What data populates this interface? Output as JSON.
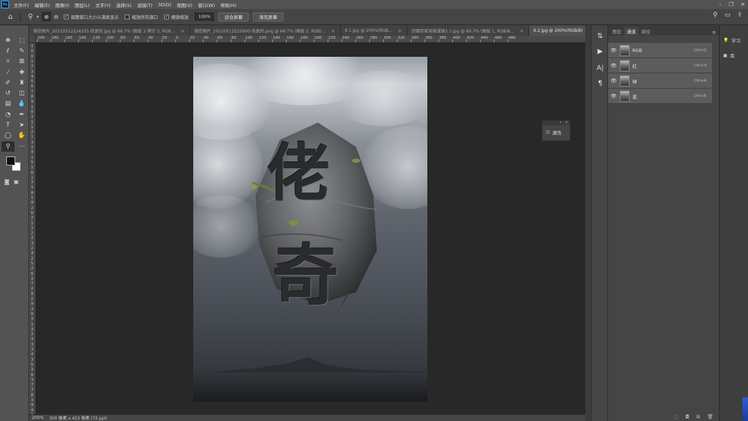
{
  "menubar": {
    "items": [
      "文件(F)",
      "编辑(E)",
      "图像(I)",
      "图层(L)",
      "文字(Y)",
      "选择(S)",
      "滤镜(T)",
      "3D(D)",
      "视图(V)",
      "窗口(W)",
      "帮助(H)"
    ]
  },
  "options_bar": {
    "check1": "调整窗口大小以满屏显示",
    "check2": "缩放所有窗口",
    "check3": "细微缩放",
    "zoom_value": "100%",
    "btn_fit": "适合屏幕",
    "btn_fill": "填充屏幕"
  },
  "tabs": [
    {
      "label": "微信图片_20210512224255-恢复的.jpg @ 66.7% (图层 2 拷贝 3, RGB..."
    },
    {
      "label": "微信图片_20210512225900-恢复的.png @ 66.7% (图层 2, RGB/..."
    },
    {
      "label": "9.1.jpg @ 200%(RGB..."
    },
    {
      "label": "封面百家突破减镜3.1.jpg @ 66.7% (图层 1, RGB/8..."
    },
    {
      "label": "9.2.jpg @ 200%(RGB/8)"
    }
  ],
  "ruler_h": [
    "200",
    "180",
    "160",
    "140",
    "120",
    "100",
    "80",
    "60",
    "40",
    "20",
    "0",
    "20",
    "40",
    "60",
    "80",
    "100",
    "120",
    "140",
    "160",
    "180",
    "200",
    "220",
    "240",
    "260",
    "280",
    "300",
    "320",
    "340",
    "360",
    "380",
    "400",
    "420",
    "440",
    "460",
    "480"
  ],
  "ruler_v": [
    "1",
    "0",
    "0",
    "1",
    "2",
    "3",
    "4",
    "5",
    "6",
    "7",
    "8",
    "9",
    "1",
    "0",
    "1",
    "1",
    "1",
    "2",
    "1",
    "3",
    "1",
    "4",
    "1",
    "5",
    "1",
    "6",
    "1",
    "7",
    "1",
    "8",
    "1",
    "9",
    "2",
    "0",
    "2",
    "1",
    "2",
    "2",
    "2",
    "3",
    "2",
    "4",
    "2",
    "5",
    "2",
    "6",
    "2",
    "7",
    "2",
    "8",
    "2",
    "9",
    "3",
    "0",
    "3",
    "1",
    "3",
    "2",
    "3",
    "3",
    "3",
    "4",
    "3",
    "5",
    "3",
    "6",
    "3",
    "7",
    "3",
    "8",
    "3",
    "9",
    "4",
    "0"
  ],
  "canvas": {
    "glyph1": "佬",
    "glyph2": "奇"
  },
  "status": {
    "zoom": "200%",
    "doc_size": "300 像素 x 423 像素 (72 ppi)"
  },
  "float_panel": {
    "label": "属性"
  },
  "panel": {
    "tabs": [
      "图层",
      "通道",
      "路径"
    ],
    "active_tab": "通道",
    "channels": [
      {
        "name": "RGB",
        "shortcut": "Ctrl+2"
      },
      {
        "name": "红",
        "shortcut": "Ctrl+3"
      },
      {
        "name": "绿",
        "shortcut": "Ctrl+4"
      },
      {
        "name": "蓝",
        "shortcut": "Ctrl+5"
      }
    ]
  },
  "right_dock": {
    "learn": "学习",
    "libraries": "库"
  },
  "colors": {
    "accent": "#31a8ff",
    "panel_bg": "#454545",
    "workspace": "#282828"
  }
}
